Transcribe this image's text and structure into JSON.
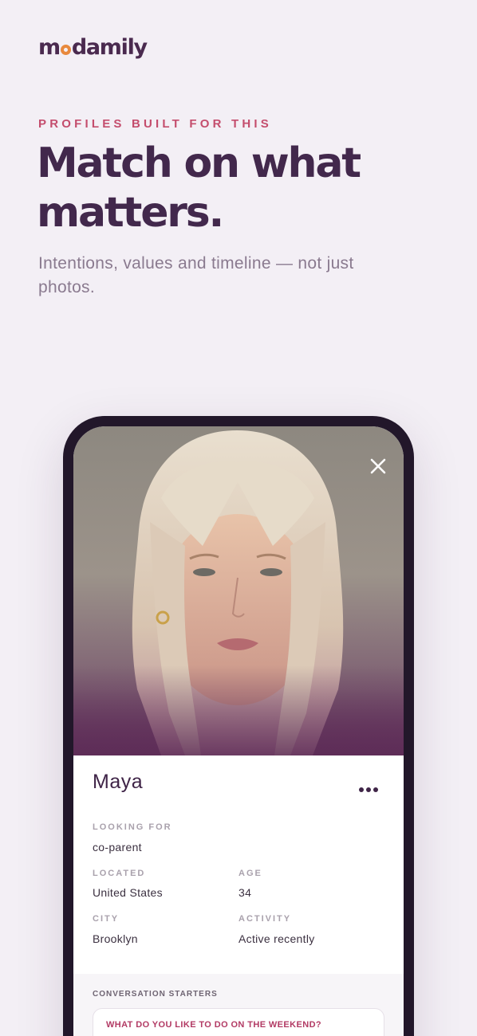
{
  "brand": {
    "logo_prefix": "m",
    "logo_suffix": "damily",
    "accent_color": "#e8893d"
  },
  "hero": {
    "eyebrow": "PROFILES BUILT FOR THIS",
    "headline": "Match on what matters.",
    "subhead": "Intentions, values and timeline — not just photos."
  },
  "profile": {
    "photo_icon": "close-icon",
    "name": "Maya",
    "menu_icon": "more-icon",
    "fields": {
      "looking_for_label": "LOOKING FOR",
      "looking_for_value": "co-parent",
      "located_label": "LOCATED",
      "located_value": "United States",
      "age_label": "AGE",
      "age_value": "34",
      "city_label": "CITY",
      "city_value": "Brooklyn",
      "activity_label": "ACTIVITY",
      "activity_value": "Active recently"
    },
    "starters": {
      "title": "CONVERSATION STARTERS",
      "question": "WHAT DO YOU LIKE TO DO ON THE WEEKEND?"
    }
  },
  "colors": {
    "background": "#f3eff5",
    "headline": "#42284c",
    "eyebrow": "#c44d6d",
    "phone_frame": "#22172a"
  }
}
